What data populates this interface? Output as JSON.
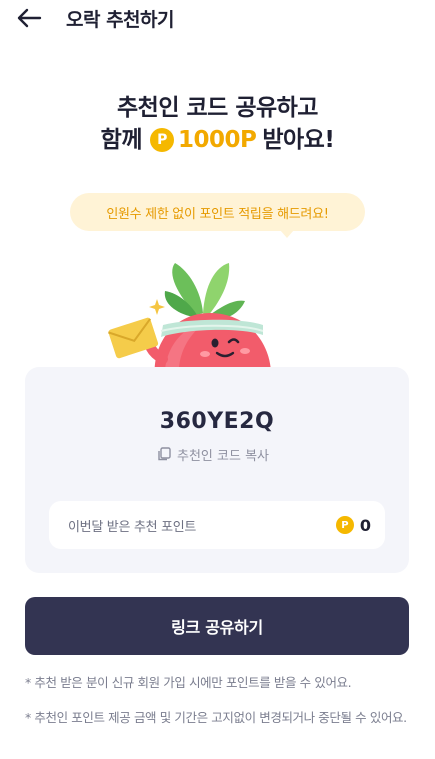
{
  "header": {
    "title": "오락 추천하기",
    "back_icon": "arrow-left-icon"
  },
  "hero": {
    "line1": "추천인 코드 공유하고",
    "line2_prefix": "함께",
    "coin_symbol": "P",
    "points": "1000P",
    "line2_suffix": "받아요!"
  },
  "tooltip": {
    "text": "인원수 제한 없이 포인트 적립을 해드려요!"
  },
  "mascot": {
    "icon": "tomato-mascot-with-envelope"
  },
  "referral": {
    "code": "360YE2Q",
    "copy_label": "추천인 코드 복사",
    "copy_icon": "copy-icon"
  },
  "monthly_points": {
    "label": "이번달 받은 추천 포인트",
    "coin_symbol": "P",
    "value": "0"
  },
  "share_button": {
    "label": "링크 공유하기"
  },
  "notes": [
    "* 추천 받은 분이 신규 회원 가입 시에만 포인트를 받을 수 있어요.",
    "* 추천인 포인트 제공 금액 및 기간은 고지없이 변경되거나 중단될 수 있어요."
  ],
  "colors": {
    "accent_gold": "#f5b800",
    "tooltip_bg": "#fff3d6",
    "button_bg": "#333452",
    "card_bg": "#f4f5fa"
  }
}
